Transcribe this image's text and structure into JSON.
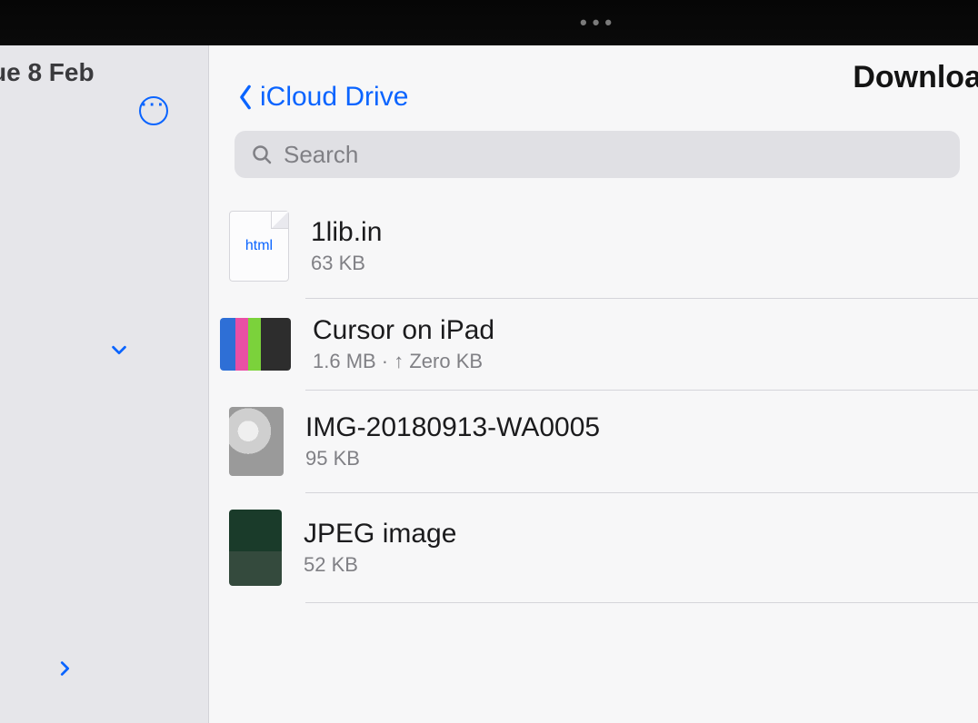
{
  "statusbar": {
    "date": "ue 8 Feb"
  },
  "sidebar": {},
  "header": {
    "back_label": "iCloud Drive",
    "title_right": "Downloa"
  },
  "search": {
    "placeholder": "Search"
  },
  "files": [
    {
      "name": "1lib.in",
      "subtitle": "63 KB",
      "thumb_type": "file",
      "thumb_label": "html"
    },
    {
      "name": "Cursor on iPad",
      "subtitle": "1.6 MB · ↑ Zero KB",
      "thumb_type": "img1",
      "thumb_label": ""
    },
    {
      "name": "IMG-20180913-WA0005",
      "subtitle": "95 KB",
      "thumb_type": "img2",
      "thumb_label": ""
    },
    {
      "name": "JPEG image",
      "subtitle": "52 KB",
      "thumb_type": "img3",
      "thumb_label": ""
    }
  ]
}
